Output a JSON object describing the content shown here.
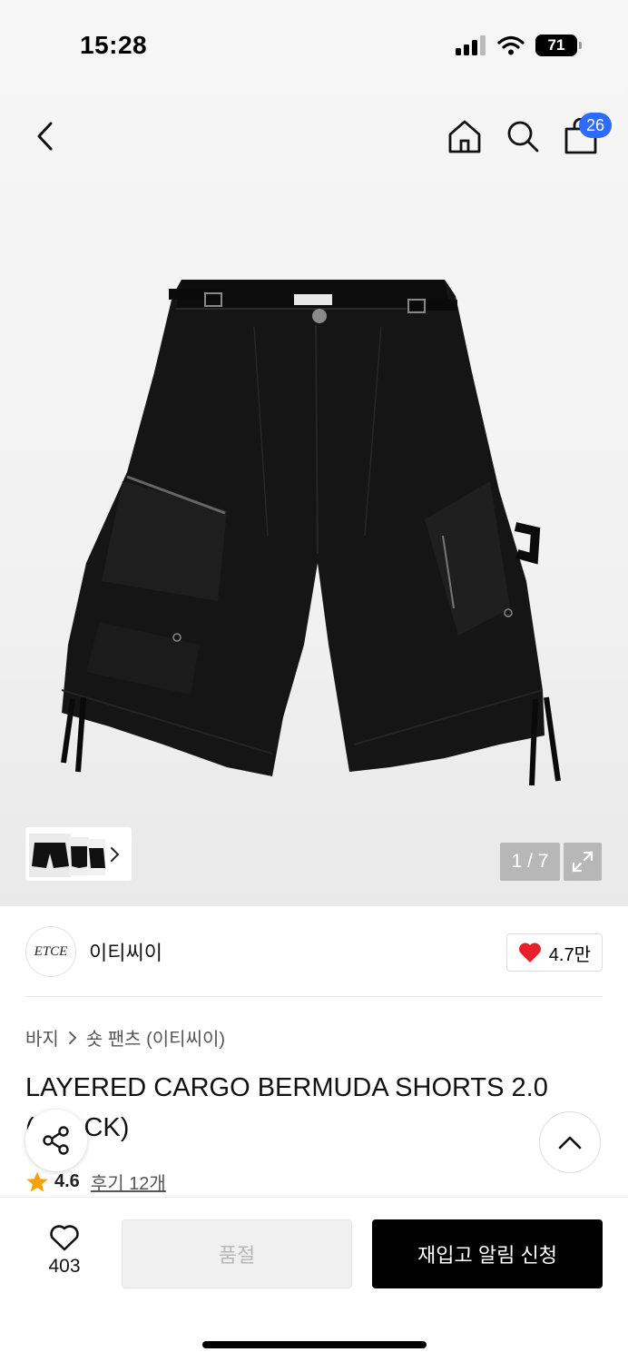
{
  "status": {
    "time": "15:28",
    "battery": "71"
  },
  "nav": {
    "cart_count": "26"
  },
  "gallery": {
    "counter": "1 / 7"
  },
  "brand": {
    "logo_text": "ETCE",
    "name": "이티씨이",
    "likes": "4.7만"
  },
  "breadcrumb": {
    "category": "바지",
    "subcategory": "숏 팬츠 (이티씨이)"
  },
  "product": {
    "title": "LAYERED CARGO BERMUDA SHORTS 2.0 (BLACK)",
    "rating": "4.6",
    "reviews": "후기 12개"
  },
  "actions": {
    "wish_count": "403",
    "soldout_label": "품절",
    "restock_label": "재입고 알림 신청"
  },
  "colors": {
    "accent": "#2f6bff",
    "heart": "#e8202a",
    "star": "#f5a10a"
  }
}
